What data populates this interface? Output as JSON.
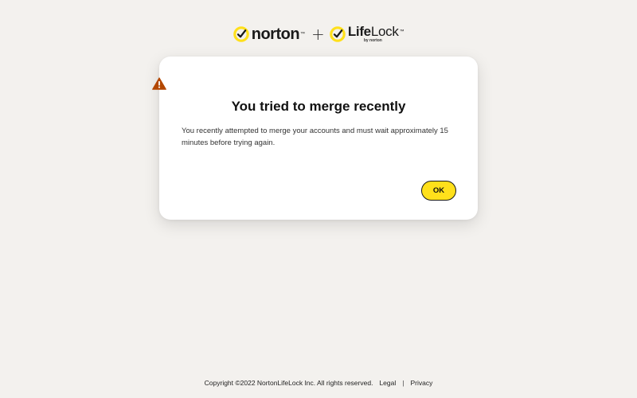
{
  "header": {
    "norton_label": "norton",
    "norton_tm": "™",
    "plus_symbol": "+",
    "lifelock_bold": "Life",
    "lifelock_regular": "Lock",
    "lifelock_tm": "™",
    "by_norton": "by norton",
    "check_icon": "norton-check-icon",
    "brand_yellow": "#ffe01b"
  },
  "dialog": {
    "icon": "warning-icon",
    "icon_color": "#b34700",
    "title": "You tried to merge recently",
    "message": "You recently attempted to merge your accounts and must wait approximately 15 minutes before trying again.",
    "ok_label": "OK",
    "ok_color": "#ffe01b"
  },
  "footer": {
    "copyright": "Copyright ©2022 NortonLifeLock Inc. All rights reserved.",
    "legal_label": "Legal",
    "separator": "|",
    "privacy_label": "Privacy"
  }
}
